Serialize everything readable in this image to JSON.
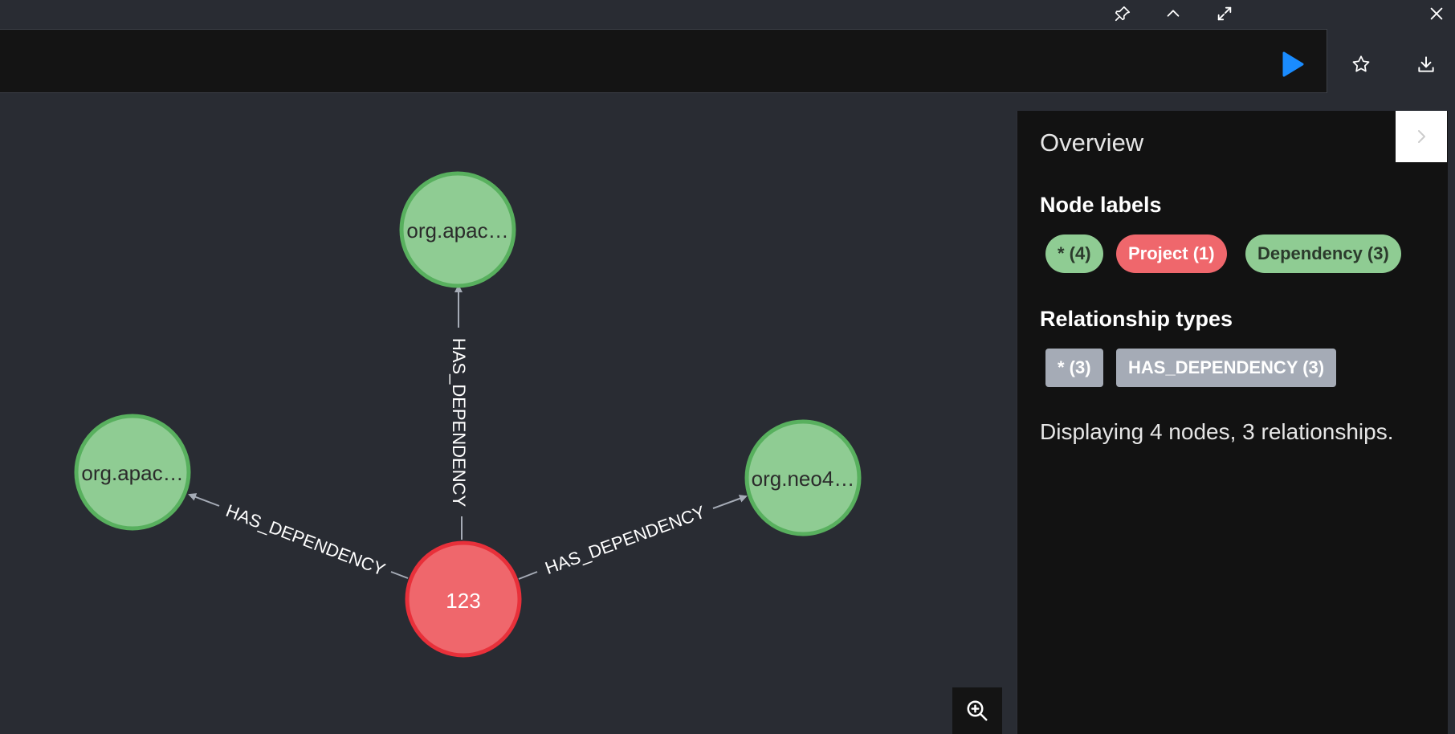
{
  "window_controls": {
    "icons": [
      "pin-icon",
      "chevron-up-icon",
      "expand-icon",
      "close-icon"
    ]
  },
  "editor": {
    "query": "",
    "play_color": "#1a8cff"
  },
  "graph": {
    "colors": {
      "dependency_fill": "#8fcc93",
      "dependency_stroke": "#58b05e",
      "project_fill": "#ef676c",
      "project_stroke": "#e8303a",
      "edge": "#a5abb6"
    },
    "nodes": [
      {
        "id": "n1",
        "label": "org.apac…",
        "type": "Dependency"
      },
      {
        "id": "n2",
        "label": "org.apac…",
        "type": "Dependency"
      },
      {
        "id": "n3",
        "label": "org.neo4…",
        "type": "Dependency"
      },
      {
        "id": "n4",
        "label": "123",
        "type": "Project"
      }
    ],
    "relationships": [
      {
        "from": "n4",
        "to": "n1",
        "label": "HAS_DEPENDENCY"
      },
      {
        "from": "n4",
        "to": "n2",
        "label": "HAS_DEPENDENCY"
      },
      {
        "from": "n4",
        "to": "n3",
        "label": "HAS_DEPENDENCY"
      }
    ]
  },
  "overview": {
    "title": "Overview",
    "node_labels_heading": "Node labels",
    "node_labels": [
      {
        "label": "* (4)",
        "bg": "#8fcc93",
        "fg": "#2b3a2c"
      },
      {
        "label": "Project (1)",
        "bg": "#ef676c",
        "fg": "#ffffff"
      },
      {
        "label": "Dependency (3)",
        "bg": "#8fcc93",
        "fg": "#2b3a2c"
      }
    ],
    "relationship_types_heading": "Relationship types",
    "relationship_types": [
      {
        "label": "* (3)"
      },
      {
        "label": "HAS_DEPENDENCY (3)"
      }
    ],
    "status": "Displaying 4 nodes, 3 relationships."
  }
}
